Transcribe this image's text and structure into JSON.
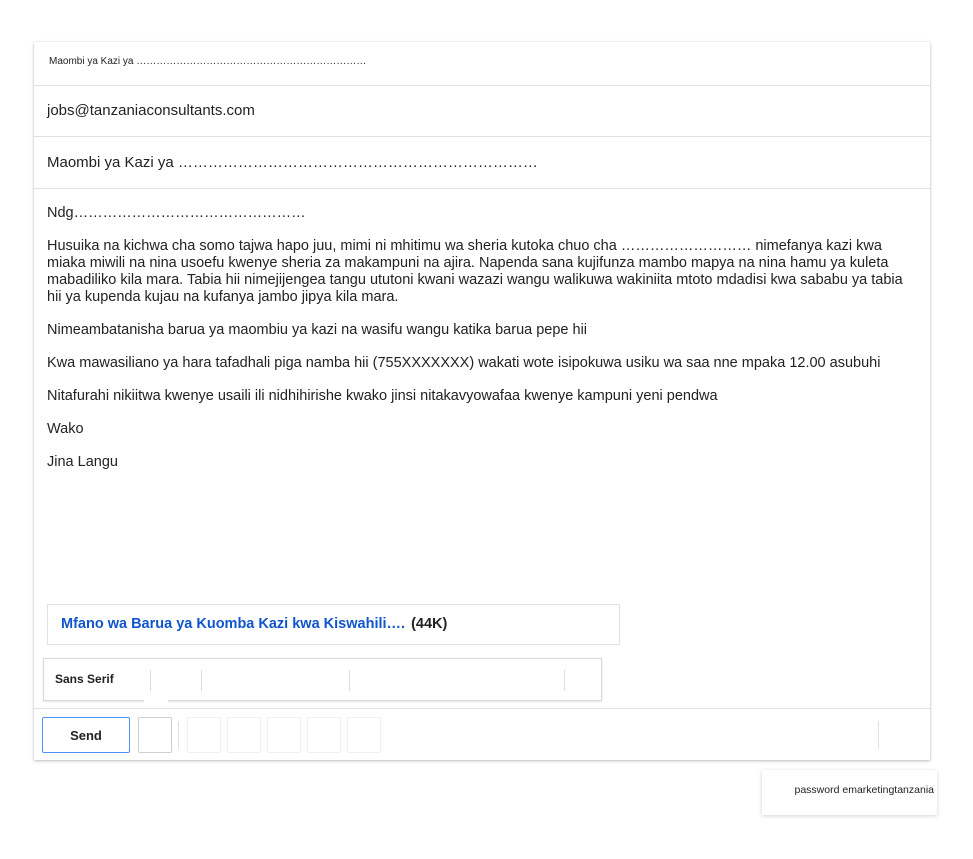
{
  "compose": {
    "title": "Maombi ya Kazi ya ……………………………………………………………",
    "to": "jobs@tanzaniaconsultants.com",
    "subject": "Maombi ya Kazi ya ………………………………………………………………",
    "body": [
      "Ndg…………………………………………",
      "Husuika na kichwa cha somo tajwa hapo juu, mimi ni mhitimu wa sheria kutoka chuo cha ……………………… nimefanya kazi kwa miaka miwili na nina usoefu kwenye sheria za makampuni na ajira. Napenda sana kujifunza mambo mapya na nina hamu ya kuleta mabadiliko kila mara. Tabia hii nimejijengea tangu ututoni kwani wazazi wangu walikuwa wakiniita mtoto mdadisi kwa sababu ya tabia hii ya kupenda kujau na kufanya jambo jipya kila mara.",
      "Nimeambatanisha barua ya maombiu ya kazi na wasifu wangu katika barua pepe hii",
      "Kwa mawasiliano ya hara tafadhali piga namba hii (755XXXXXXX) wakati wote isipokuwa usiku wa saa nne mpaka 12.00 asubuhi",
      "Nitafurahi nikiitwa kwenye usaili ili nidhihirishe kwako jinsi nitakavyowafaa kwenye kampuni yeni pendwa",
      "Wako",
      "Jina Langu"
    ],
    "attachment": {
      "name": "Mfano wa Barua ya Kuomba Kazi kwa Kiswahili….",
      "size": "(44K)"
    },
    "formatting": {
      "font": "Sans Serif"
    },
    "send_label": "Send"
  },
  "tooltip": {
    "text": "password emarketingtanzania"
  },
  "colors": {
    "link": "#1155cc",
    "send_border": "#4d90fe"
  }
}
